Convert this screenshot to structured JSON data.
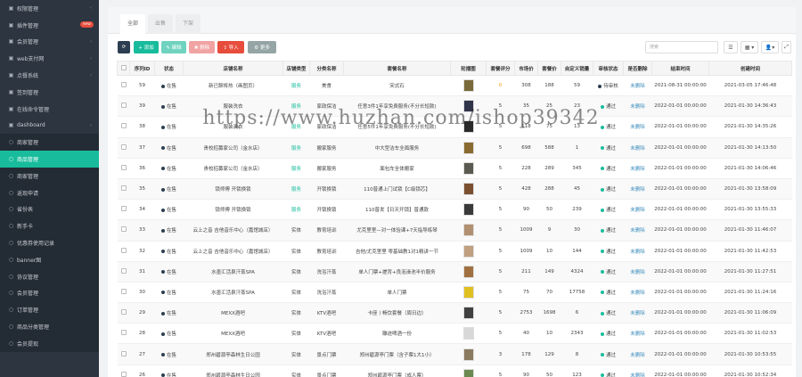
{
  "sidebar": {
    "items": [
      {
        "label": "权限管理",
        "icon": "group-icon",
        "chev": true
      },
      {
        "label": "插件管理",
        "icon": "rocket-icon",
        "badge": "new"
      },
      {
        "label": "会员管理",
        "icon": "user-icon",
        "chev": true
      },
      {
        "label": "web支付网",
        "icon": "globe-icon",
        "chev": true
      },
      {
        "label": "点餐系统",
        "icon": "shop-icon",
        "chev": true
      },
      {
        "label": "签到管理",
        "icon": "calendar-icon",
        "chev": false
      },
      {
        "label": "在线命令管理",
        "icon": "terminal-icon",
        "chev": false
      },
      {
        "label": "dashboard",
        "icon": "dashboard-icon",
        "chev": true
      },
      {
        "label": "商家管理",
        "icon": "circle-icon",
        "sub": true
      },
      {
        "label": "商品管理",
        "icon": "circle-icon",
        "sub": true,
        "active": true
      },
      {
        "label": "商家管理",
        "icon": "circle-icon",
        "sub": true
      },
      {
        "label": "返现申请",
        "icon": "circle-icon",
        "sub": true
      },
      {
        "label": "省份表",
        "icon": "circle-icon",
        "sub": true
      },
      {
        "label": "新手卡",
        "icon": "circle-icon",
        "sub": true
      },
      {
        "label": "优惠券使用记录",
        "icon": "circle-icon",
        "sub": true
      },
      {
        "label": "banner图",
        "icon": "circle-icon",
        "sub": true
      },
      {
        "label": "协议管理",
        "icon": "circle-icon",
        "sub": true
      },
      {
        "label": "会员管理",
        "icon": "circle-icon",
        "sub": true
      },
      {
        "label": "订单管理",
        "icon": "circle-icon",
        "sub": true
      },
      {
        "label": "商品分类管理",
        "icon": "circle-icon",
        "sub": true
      },
      {
        "label": "会员提现",
        "icon": "circle-icon",
        "sub": true
      }
    ]
  },
  "tabs": [
    {
      "label": "全部",
      "active": true
    },
    {
      "label": "出售",
      "active": false
    },
    {
      "label": "下架",
      "active": false
    }
  ],
  "toolbar": {
    "refresh": "⟳",
    "add": "+ 添加",
    "edit": "✎ 编辑",
    "del": "✖ 删除",
    "import": "⇪ 导入",
    "more": "⚙ 更多",
    "search_placeholder": "搜索",
    "view_list": "☰",
    "view_grid": "▦ ▾",
    "columns": "👤▾",
    "fullscreen": "⤢"
  },
  "table": {
    "headers": [
      "",
      "序列ID",
      "状态",
      "店铺名称",
      "店铺类型",
      "分类名称",
      "套餐名称",
      "轮播图",
      "套餐评分",
      "市场价",
      "套餐价",
      "自定义销量",
      "审核状态",
      "是否删除",
      "结束时间",
      "创建时间"
    ],
    "rows": [
      {
        "id": "59",
        "status": "在售",
        "shop": "新已聊将热（画图页）",
        "type": "服务",
        "cat": "美食",
        "pkg": "宋式石",
        "img": "#7a6a3a",
        "score": "0",
        "market": "308",
        "price": "188",
        "sales": "59",
        "audit": "待审核",
        "audit_color": "dark",
        "del": "未删除",
        "end": "2021-08-31 00:00:00",
        "created": "2021-03-05 17:46:48"
      },
      {
        "id": "39",
        "status": "在售",
        "shop": "服装洗衣",
        "type": "服务",
        "cat": "家政保洁",
        "pkg": "任意3件1年享免费服务(不分长短款)",
        "img": "#30344a",
        "score": "5",
        "market": "35",
        "price": "25",
        "sales": "23",
        "audit": "通过",
        "audit_color": "green",
        "del": "未删除",
        "end": "2022-01-01 00:00:00",
        "created": "2021-01-30 14:36:43"
      },
      {
        "id": "38",
        "status": "在售",
        "shop": "服装洗衣",
        "type": "服务",
        "cat": "家政保洁",
        "pkg": "任意5件1年享免费服务(不分长短款)",
        "img": "#2a2a2a",
        "score": "5",
        "market": "118",
        "price": "75",
        "sales": "13",
        "audit": "通过",
        "audit_color": "green",
        "del": "未删除",
        "end": "2022-01-01 00:00:00",
        "created": "2021-01-30 14:35:26"
      },
      {
        "id": "37",
        "status": "在售",
        "shop": "贵校招募家公司（金水店）",
        "type": "服务",
        "cat": "搬家服务",
        "pkg": "中大型洁车全面服务",
        "img": "#8a6a30",
        "score": "5",
        "market": "698",
        "price": "588",
        "sales": "1",
        "audit": "通过",
        "audit_color": "green",
        "del": "未删除",
        "end": "2022-01-01 00:00:00",
        "created": "2021-01-30 14:13:50"
      },
      {
        "id": "36",
        "status": "在售",
        "shop": "贵校招募家公司（金水店）",
        "type": "服务",
        "cat": "搬家服务",
        "pkg": "面包车全体搬家",
        "img": "#5a5a50",
        "score": "5",
        "market": "228",
        "price": "289",
        "sales": "345",
        "audit": "通过",
        "audit_color": "green",
        "del": "未删除",
        "end": "2022-01-01 00:00:00",
        "created": "2021-01-30 14:06:46"
      },
      {
        "id": "35",
        "status": "在售",
        "shop": "锁师傅 开锁换锁",
        "type": "服务",
        "cat": "开锁换锁",
        "pkg": "110普通上门试锁【C级锁芯】",
        "img": "#7a5030",
        "score": "5",
        "market": "428",
        "price": "288",
        "sales": "45",
        "audit": "通过",
        "audit_color": "green",
        "del": "未删除",
        "end": "2022-01-01 00:00:00",
        "created": "2021-01-30 13:58:09"
      },
      {
        "id": "34",
        "status": "在售",
        "shop": "锁师傅 开锁换锁",
        "type": "服务",
        "cat": "开锁换锁",
        "pkg": "110普发【日天开锁】普通款",
        "img": "#3a3a3a",
        "score": "5",
        "market": "90",
        "price": "50",
        "sales": "239",
        "audit": "通过",
        "audit_color": "green",
        "del": "未删除",
        "end": "2022-01-01 00:00:00",
        "created": "2021-01-30 13:55:33"
      },
      {
        "id": "33",
        "status": "在售",
        "shop": "云上之音 吉他音乐中心（嘉馆城店）",
        "type": "实体",
        "cat": "教育培训",
        "pkg": "尤克里里—对一体验课+7天指导练琴",
        "img": "#b09070",
        "score": "5",
        "market": "1009",
        "price": "9",
        "sales": "30",
        "audit": "通过",
        "audit_color": "green",
        "del": "未删除",
        "end": "2022-01-01 00:00:00",
        "created": "2021-01-30 11:46:07"
      },
      {
        "id": "32",
        "status": "在售",
        "shop": "云上之音 吉他音乐中心（嘉馆城店）",
        "type": "实体",
        "cat": "教育培训",
        "pkg": "吉他/尤克里里 零基础教1对1精讲一节",
        "img": "#c0a080",
        "score": "5",
        "market": "1009",
        "price": "10",
        "sales": "144",
        "audit": "通过",
        "audit_color": "green",
        "del": "未删除",
        "end": "2022-01-01 00:00:00",
        "created": "2021-01-30 11:42:53"
      },
      {
        "id": "31",
        "status": "在售",
        "shop": "水墨汇活泉汗蒸SPA",
        "type": "实体",
        "cat": "洗浴汗蒸",
        "pkg": "单人门票+搓背+良泡澡池半价服务",
        "img": "#a07040",
        "score": "5",
        "market": "211",
        "price": "149",
        "sales": "4324",
        "audit": "通过",
        "audit_color": "green",
        "del": "未删除",
        "end": "2022-01-01 00:00:00",
        "created": "2021-01-30 11:27:51"
      },
      {
        "id": "30",
        "status": "在售",
        "shop": "水墨汇活泉汗蒸SPA",
        "type": "实体",
        "cat": "洗浴汗蒸",
        "pkg": "单人门票",
        "img": "#e0c020",
        "score": "5",
        "market": "75",
        "price": "70",
        "sales": "17758",
        "audit": "通过",
        "audit_color": "green",
        "del": "未删除",
        "end": "2022-01-01 00:00:00",
        "created": "2021-01-30 11:24:16"
      },
      {
        "id": "29",
        "status": "在售",
        "shop": "MEXX酒吧",
        "type": "实体",
        "cat": "KTV酒吧",
        "pkg": "卡座丨畅饮套餐（周日边）",
        "img": "#404040",
        "score": "5",
        "market": "2753",
        "price": "1698",
        "sales": "6",
        "audit": "通过",
        "audit_color": "green",
        "del": "未删除",
        "end": "2022-01-01 00:00:00",
        "created": "2021-01-30 11:06:09"
      },
      {
        "id": "28",
        "status": "在售",
        "shop": "MEXX酒吧",
        "type": "实体",
        "cat": "KTV酒吧",
        "pkg": "雕迹啤酒一份",
        "img": "#d8d8d8",
        "score": "5",
        "market": "40",
        "price": "10",
        "sales": "2343",
        "audit": "通过",
        "audit_color": "green",
        "del": "未删除",
        "end": "2022-01-01 00:00:00",
        "created": "2021-01-30 11:02:53"
      },
      {
        "id": "27",
        "status": "在售",
        "shop": "郑州碧源亭森林生日公园",
        "type": "实体",
        "cat": "景点门票",
        "pkg": "郑州碧源亭门票（含子票1大1小）",
        "img": "#8a7a60",
        "score": "3",
        "market": "178",
        "price": "129",
        "sales": "8",
        "audit": "通过",
        "audit_color": "green",
        "del": "未删除",
        "end": "2022-01-01 00:00:00",
        "created": "2021-01-30 10:53:55"
      },
      {
        "id": "26",
        "status": "在售",
        "shop": "郑州碧源亭森林生日公园",
        "type": "实体",
        "cat": "景点门票",
        "pkg": "郑州碧源亭门票（成人票）",
        "img": "#6a8a50",
        "score": "5",
        "market": "90",
        "price": "50",
        "sales": "123",
        "audit": "通过",
        "audit_color": "green",
        "del": "未删除",
        "end": "2022-01-01 00:00:00",
        "created": "2021-01-30 10:52:34"
      }
    ]
  },
  "watermark": "https://www.huzhan.com/ishop39342",
  "colors": {
    "accent": "#18bc9c",
    "sidebar": "#2c3540",
    "danger": "#e74c3c"
  }
}
